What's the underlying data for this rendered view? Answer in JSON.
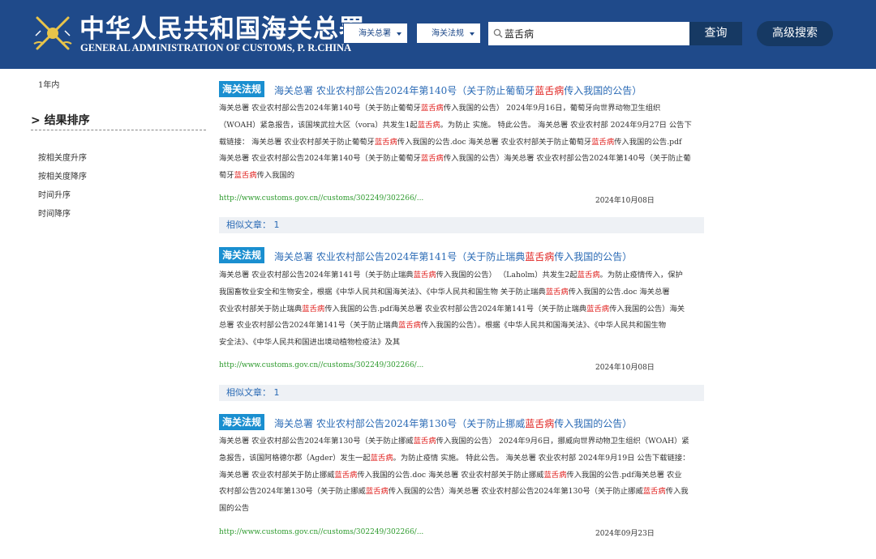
{
  "header": {
    "title_cn": "中华人民共和国海关总署",
    "title_en": "GENERAL ADMINISTRATION OF CUSTOMS, P. R.CHINA",
    "scope_select": "海关总署",
    "type_select": "海关法规",
    "search_value": "蓝舌病",
    "query_label": "查询",
    "advanced_label": "高级搜索",
    "colors": {
      "bar": "#1f4a8a",
      "button": "#163963"
    }
  },
  "sidebar": {
    "time_filter": "1年内",
    "sort_heading": "> 结果排序",
    "sort_options": [
      "按相关度升序",
      "按相关度降序",
      "时间升序",
      "时间降序"
    ]
  },
  "results": [
    {
      "tag": "海关法规",
      "title_parts": [
        "海关总署 农业农村部公告2024年第140号（关于防止葡萄牙",
        "蓝舌病",
        "传入我国的公告）"
      ],
      "snippet_lines": [
        [
          "海关总署 农业农村部公告2024年第140号（关于防止葡萄牙",
          "蓝舌病",
          "传入我国的公告） 2024年9月16日，葡萄牙向世界动物卫生组织"
        ],
        [
          "（WOAH）紧急报告，该国埃武拉大区（vora）共发生1起",
          "蓝舌病",
          "。为防止 实施。 特此公告。 海关总署 农业农村部 2024年9月27日 公告下"
        ],
        [
          "载链接： 海关总署 农业农村部关于防止葡萄牙",
          "蓝舌病",
          "传入我国的公告.doc 海关总署 农业农村部关于防止葡萄牙",
          "蓝舌病",
          "传入我国的公告.pdf"
        ],
        [
          "海关总署 农业农村部公告2024年第140号（关于防止葡萄牙",
          "蓝舌病",
          "传入我国的公告）海关总署 农业农村部公告2024年第140号（关于防止葡"
        ],
        [
          "萄牙",
          "蓝舌病",
          "传入我国的"
        ]
      ],
      "url": "http://www.customs.gov.cn//customs/302249/302266/...",
      "date": "2024年10月08日",
      "similar": "相似文章：  1"
    },
    {
      "tag": "海关法规",
      "title_parts": [
        "海关总署 农业农村部公告2024年第141号（关于防止瑞典",
        "蓝舌病",
        "传入我国的公告）"
      ],
      "snippet_lines": [
        [
          "海关总署 农业农村部公告2024年第141号（关于防止瑞典",
          "蓝舌病",
          "传入我国的公告） （Laholm）共发生2起",
          "蓝舌病",
          "。为防止疫情传入，保护"
        ],
        [
          "我国畜牧业安全和生物安全，根据《中华人民共和国海关法》、《中华人民共和国生物 关于防止瑞典",
          "蓝舌病",
          "传入我国的公告.doc 海关总署"
        ],
        [
          "农业农村部关于防止瑞典",
          "蓝舌病",
          "传入我国的公告.pdf海关总署 农业农村部公告2024年第141号（关于防止瑞典",
          "蓝舌病",
          "传入我国的公告）海关"
        ],
        [
          "总署 农业农村部公告2024年第141号（关于防止瑞典",
          "蓝舌病",
          "传入我国的公告）。根据《中华人民共和国海关法》、《中华人民共和国生物"
        ],
        [
          "安全法》、《中华人民共和国进出境动植物检疫法》及其"
        ]
      ],
      "url": "http://www.customs.gov.cn//customs/302249/302266/...",
      "date": "2024年10月08日",
      "similar": "相似文章：  1"
    },
    {
      "tag": "海关法规",
      "title_parts": [
        "海关总署 农业农村部公告2024年第130号（关于防止挪威",
        "蓝舌病",
        "传入我国的公告）"
      ],
      "snippet_lines": [
        [
          "海关总署 农业农村部公告2024年第130号（关于防止挪威",
          "蓝舌病",
          "传入我国的公告） 2024年9月6日，挪威向世界动物卫生组织（WOAH）紧"
        ],
        [
          "急报告，该国阿格德尔郡（Agder）发生一起",
          "蓝舌病",
          "。为防止疫情 实施。 特此公告。 海关总署 农业农村部 2024年9月19日 公告下载链接："
        ],
        [
          "海关总署 农业农村部关于防止挪威",
          "蓝舌病",
          "传入我国的公告.doc 海关总署 农业农村部关于防止挪威",
          "蓝舌病",
          "传入我国的公告.pdf海关总署 农业"
        ],
        [
          "农村部公告2024年第130号（关于防止挪威",
          "蓝舌病",
          "传入我国的公告）海关总署 农业农村部公告2024年第130号（关于防止挪威",
          "蓝舌病",
          "传入我"
        ],
        [
          "国的公告"
        ]
      ],
      "url": "http://www.customs.gov.cn//customs/302249/302266/...",
      "date": "2024年09月23日"
    }
  ]
}
